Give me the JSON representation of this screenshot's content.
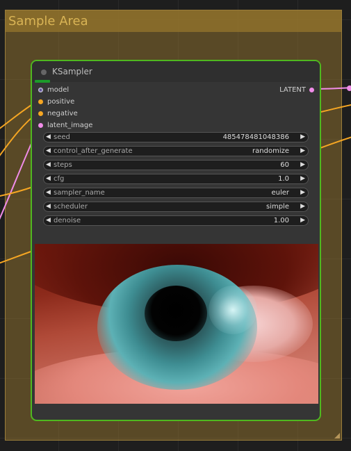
{
  "group": {
    "title": "Sample Area"
  },
  "node": {
    "title": "KSampler",
    "inputs": [
      {
        "label": "model",
        "color": "#ffffff"
      },
      {
        "label": "positive",
        "color": "#f5a623"
      },
      {
        "label": "negative",
        "color": "#f5a623"
      },
      {
        "label": "latent_image",
        "color": "#f08ce8"
      }
    ],
    "output": {
      "label": "LATENT",
      "color": "#f08ce8"
    },
    "widgets": [
      {
        "name": "seed",
        "value": "485478481048386"
      },
      {
        "name": "control_after_generate",
        "value": "randomize"
      },
      {
        "name": "steps",
        "value": "60"
      },
      {
        "name": "cfg",
        "value": "1.0"
      },
      {
        "name": "sampler_name",
        "value": "euler"
      },
      {
        "name": "scheduler",
        "value": "simple"
      },
      {
        "name": "denoise",
        "value": "1.00"
      }
    ],
    "arrow_left": "◀",
    "arrow_right": "▶"
  },
  "colors": {
    "wire_conditioning": "#f5a623",
    "wire_latent": "#f08ce8",
    "node_border_active": "#4fb81f",
    "group_title": "#d9b455"
  }
}
